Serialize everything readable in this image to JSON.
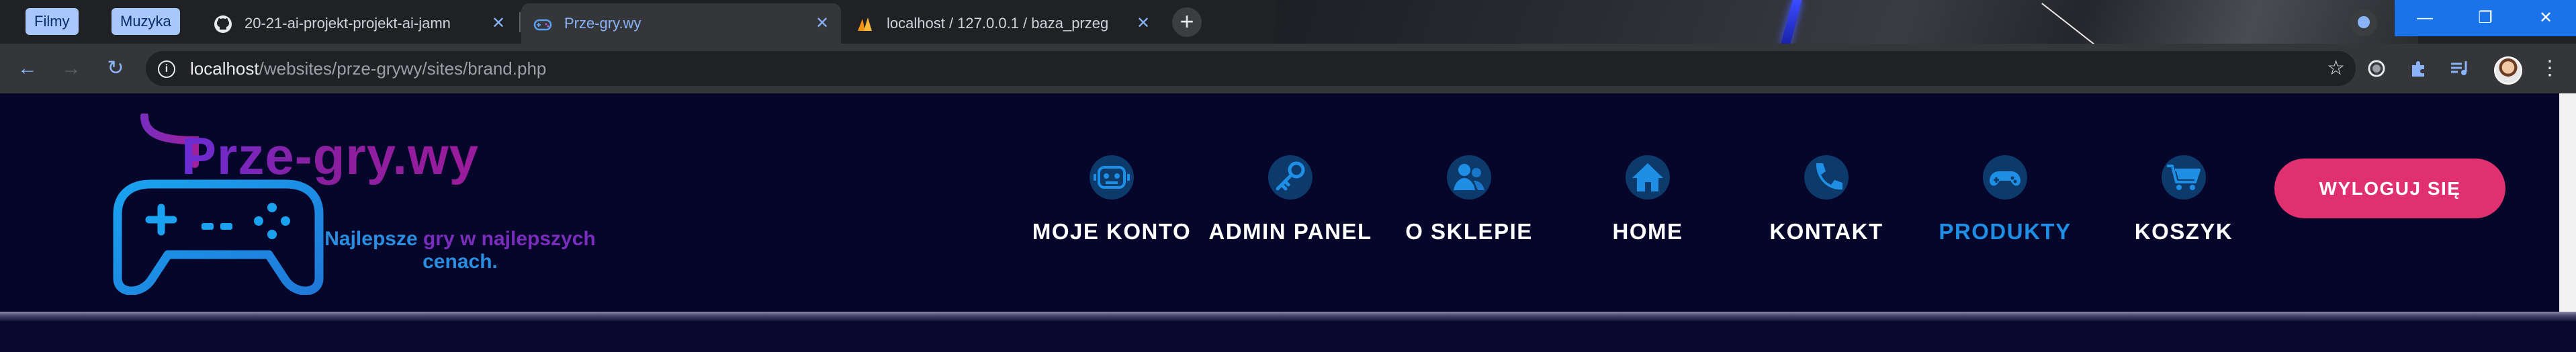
{
  "browser": {
    "bookmarks": [
      "Filmy",
      "Muzyka"
    ],
    "tabs": [
      {
        "title": "20-21-ai-projekt-projekt-ai-jamn",
        "favicon": "github-icon",
        "active": false
      },
      {
        "title": "Prze-gry.wy",
        "favicon": "gamepad-icon",
        "active": true
      },
      {
        "title": "localhost / 127.0.0.1 / baza_przeg",
        "favicon": "phpmyadmin-icon",
        "active": false
      }
    ],
    "new_tab": "+",
    "window_controls": {
      "minimize": "—",
      "restore": "❐",
      "close": "✕"
    },
    "address": {
      "host": "localhost",
      "path": "/websites/prze-grywy/sites/brand.php"
    },
    "nav": {
      "back": "←",
      "forward": "→",
      "reload": "↻"
    },
    "star": "☆",
    "menu": "⋮"
  },
  "site": {
    "logo": {
      "wordmark": "Prze-gry.wy",
      "tagline_blue": "Najlepsze ",
      "tagline_purple": "gry w najlepszych",
      "tagline_line2": "cenach."
    },
    "nav": [
      {
        "label": "MOJE KONTO",
        "icon": "user-robot-icon",
        "active": false
      },
      {
        "label": "ADMIN PANEL",
        "icon": "key-icon",
        "active": false
      },
      {
        "label": "O SKLEPIE",
        "icon": "people-icon",
        "active": false
      },
      {
        "label": "HOME",
        "icon": "house-icon",
        "active": false
      },
      {
        "label": "KONTAKT",
        "icon": "phone-icon",
        "active": false
      },
      {
        "label": "PRODUKTY",
        "icon": "gamepad-icon",
        "active": true
      },
      {
        "label": "KOSZYK",
        "icon": "cart-icon",
        "active": false
      }
    ],
    "logout_label": "WYLOGUJ SIĘ"
  },
  "colors": {
    "page_bg": "#06052a",
    "accent_blue": "#1f8fe5",
    "accent_purple": "#8a1f9f",
    "logout_bg": "#e0306f"
  }
}
